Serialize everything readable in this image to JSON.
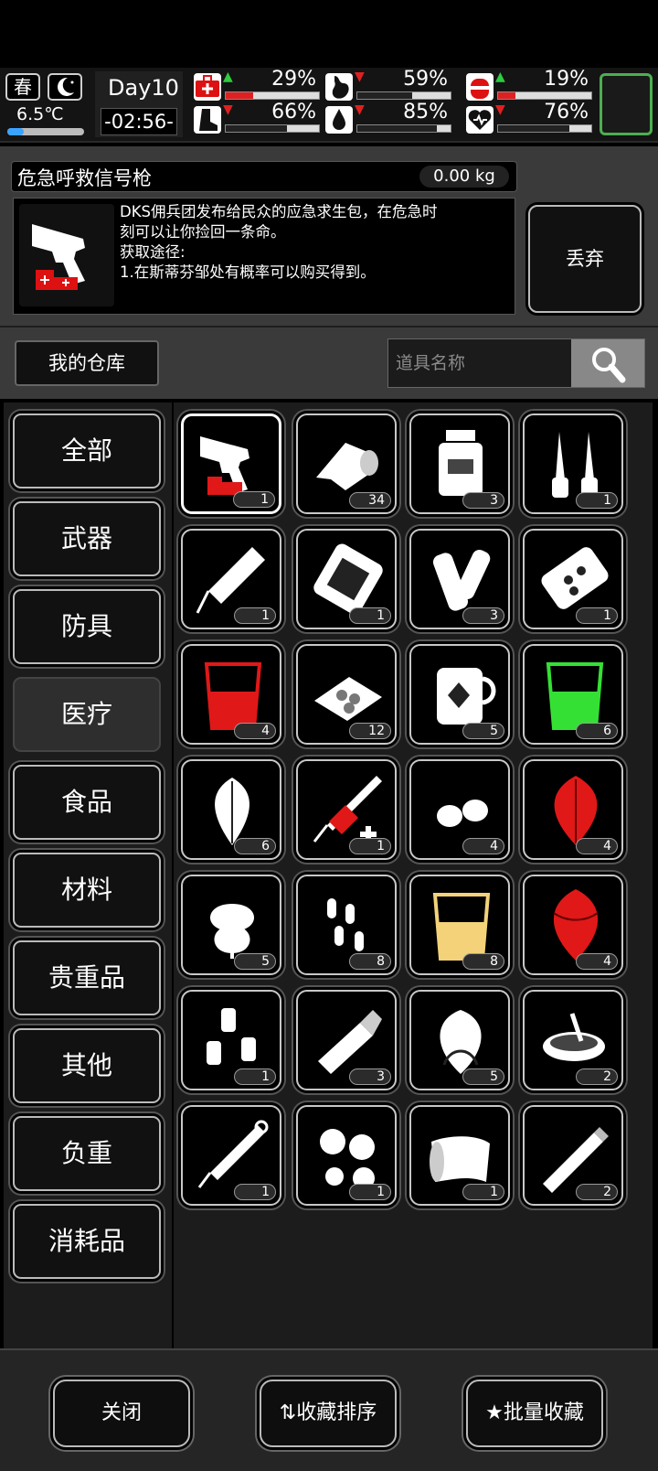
{
  "hud": {
    "season": "春",
    "temperature": "6.5℃",
    "day": "Day10",
    "clock": "-02:56-",
    "stats": [
      {
        "icon": "medkit-icon",
        "trend": "up",
        "value": "29%",
        "color": "#e02020",
        "level": 0.29
      },
      {
        "icon": "stomach-icon",
        "trend": "down",
        "value": "59%",
        "color": "#ffffff",
        "level": 0.59
      },
      {
        "icon": "battery-icon",
        "trend": "up",
        "value": "19%",
        "color": "#e02020",
        "level": 0.19
      },
      {
        "icon": "boot-icon",
        "trend": "down",
        "value": "66%",
        "color": "#ffffff",
        "level": 0.66
      },
      {
        "icon": "water-drop-icon",
        "trend": "down",
        "value": "85%",
        "color": "#ffffff",
        "level": 0.85
      },
      {
        "icon": "heart-icon",
        "trend": "down",
        "value": "76%",
        "color": "#ffffff",
        "level": 0.76
      }
    ]
  },
  "detail": {
    "name": "危急呼救信号枪",
    "weight": "0.00 kg",
    "description": "DKS佣兵团发布给民众的应急求生包，在危急时\n刻可以让你捡回一条命。\n获取途径:\n1.在斯蒂芬邹处有概率可以购买得到。",
    "discard": "丢弃"
  },
  "warehouse": {
    "button": "我的仓库",
    "search_placeholder": "道具名称"
  },
  "categories": [
    "全部",
    "武器",
    "防具",
    "医疗",
    "食品",
    "材料",
    "贵重品",
    "其他",
    "负重",
    "消耗品"
  ],
  "active_category": "医疗",
  "items": [
    {
      "icon": "flare-gun-icon",
      "count": "1"
    },
    {
      "icon": "bandage-roll-icon",
      "count": "34"
    },
    {
      "icon": "medicine-bottle-icon",
      "count": "3"
    },
    {
      "icon": "ampoules-icon",
      "count": "1"
    },
    {
      "icon": "auto-injector-icon",
      "count": "1"
    },
    {
      "icon": "pill-pack-icon",
      "count": "1"
    },
    {
      "icon": "splint-icon",
      "count": "3"
    },
    {
      "icon": "blister-pack-icon",
      "count": "1"
    },
    {
      "icon": "red-potion-glass-icon",
      "count": "4"
    },
    {
      "icon": "tablets-tray-icon",
      "count": "12"
    },
    {
      "icon": "herbal-tea-jug-icon",
      "count": "5"
    },
    {
      "icon": "green-potion-glass-icon",
      "count": "6"
    },
    {
      "icon": "mint-leaf-icon",
      "count": "6"
    },
    {
      "icon": "syringe-red-icon",
      "count": "1"
    },
    {
      "icon": "seeds-icon",
      "count": "4"
    },
    {
      "icon": "red-herb-icon",
      "count": "4"
    },
    {
      "icon": "herb-plant-icon",
      "count": "5"
    },
    {
      "icon": "capsules-icon",
      "count": "8"
    },
    {
      "icon": "yellow-potion-glass-icon",
      "count": "8"
    },
    {
      "icon": "red-basil-icon",
      "count": "4"
    },
    {
      "icon": "small-vials-icon",
      "count": "1"
    },
    {
      "icon": "ointment-tube-icon",
      "count": "3"
    },
    {
      "icon": "root-herb-icon",
      "count": "5"
    },
    {
      "icon": "porridge-bowl-icon",
      "count": "2"
    },
    {
      "icon": "syringe-icon",
      "count": "1"
    },
    {
      "icon": "round-pills-icon",
      "count": "1"
    },
    {
      "icon": "elastic-bandage-icon",
      "count": "1"
    },
    {
      "icon": "cigarette-icon",
      "count": "2"
    }
  ],
  "footer": {
    "close": "关闭",
    "sort_favorites": "收藏排序",
    "batch_favorite": "批量收藏"
  }
}
